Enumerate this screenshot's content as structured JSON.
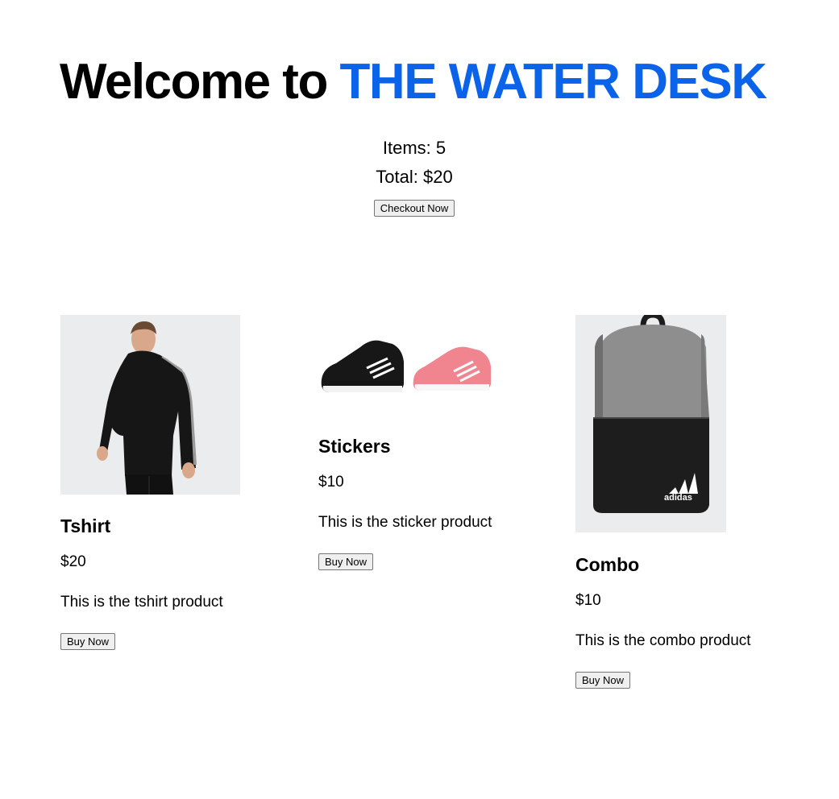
{
  "header": {
    "title_prefix": "Welcome to",
    "title_brand": "THE WATER DESK"
  },
  "cart": {
    "items_text": "Items: 5",
    "total_text": "Total: $20",
    "checkout_label": "Checkout Now"
  },
  "products": [
    {
      "name": "Tshirt",
      "price": "$20",
      "description": "This is the tshirt product",
      "button": "Buy Now",
      "image_icon": "hoodie-model-icon"
    },
    {
      "name": "Stickers",
      "price": "$10",
      "description": "This is the sticker product",
      "button": "Buy Now",
      "image_icon": "sneakers-icon"
    },
    {
      "name": "Combo",
      "price": "$10",
      "description": "This is the combo product",
      "button": "Buy Now",
      "image_icon": "backpack-icon"
    }
  ],
  "colors": {
    "brand": "#0a63e8",
    "image_bg": "#ebeced"
  }
}
